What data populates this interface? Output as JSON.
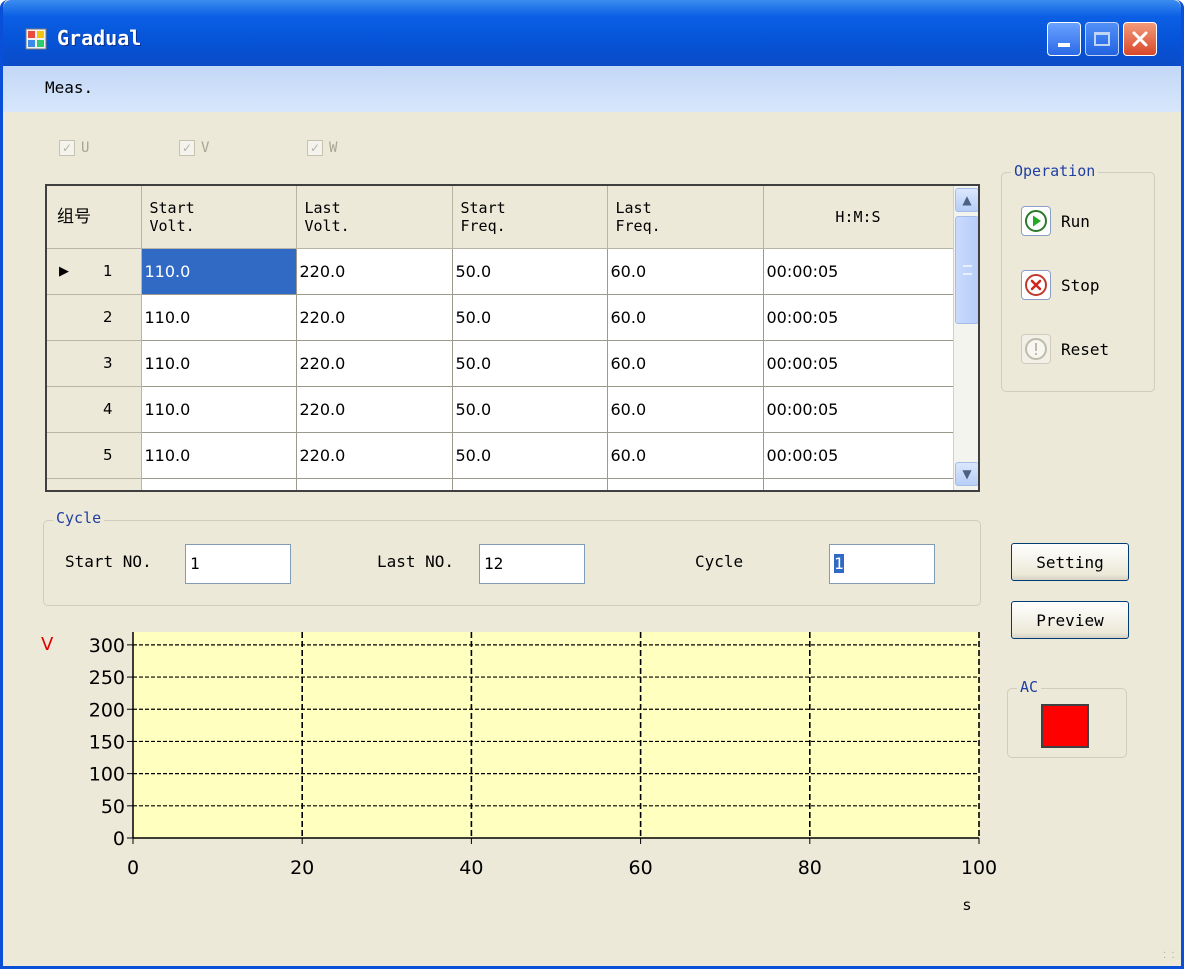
{
  "window": {
    "title": "Gradual",
    "minimize_label": "_",
    "maximize_label": "□",
    "close_label": "✕"
  },
  "menu": {
    "items": [
      "Meas."
    ]
  },
  "phases": [
    {
      "label": "U",
      "checked": true,
      "enabled": false
    },
    {
      "label": "V",
      "checked": true,
      "enabled": false
    },
    {
      "label": "W",
      "checked": true,
      "enabled": false
    }
  ],
  "grid": {
    "corner_header": "组号",
    "columns": [
      "Start\nVolt.",
      "Last\nVolt.",
      "Start\nFreq.",
      "Last\nFreq.",
      "H:M:S"
    ],
    "rows": [
      {
        "no": "1",
        "cells": [
          "110.0",
          "220.0",
          "50.0",
          "60.0",
          "00:00:05"
        ]
      },
      {
        "no": "2",
        "cells": [
          "110.0",
          "220.0",
          "50.0",
          "60.0",
          "00:00:05"
        ]
      },
      {
        "no": "3",
        "cells": [
          "110.0",
          "220.0",
          "50.0",
          "60.0",
          "00:00:05"
        ]
      },
      {
        "no": "4",
        "cells": [
          "110.0",
          "220.0",
          "50.0",
          "60.0",
          "00:00:05"
        ]
      },
      {
        "no": "5",
        "cells": [
          "110.0",
          "220.0",
          "50.0",
          "60.0",
          "00:00:05"
        ]
      }
    ],
    "current_row_indicator": "▶"
  },
  "operation": {
    "title": "Operation",
    "run_label": "Run",
    "stop_label": "Stop",
    "reset_label": "Reset"
  },
  "cycle": {
    "title": "Cycle",
    "start_label": "Start NO.",
    "start_value": "1",
    "last_label": "Last NO.",
    "last_value": "12",
    "cycle_label": "Cycle",
    "cycle_value": "1"
  },
  "buttons": {
    "setting": "Setting",
    "preview": "Preview"
  },
  "ac": {
    "title": "AC",
    "color": "#ff0000"
  },
  "colors": {
    "plot_bg": "#ffffc0",
    "ylabel": "#e00000",
    "selection": "#316ac5"
  },
  "chart_data": {
    "type": "line",
    "ylabel": "V",
    "xlabel": "s",
    "xlim": [
      0,
      100
    ],
    "ylim": [
      0,
      320
    ],
    "x_ticks": [
      0,
      20,
      40,
      60,
      80,
      100
    ],
    "y_ticks": [
      0,
      50,
      100,
      150,
      200,
      250,
      300
    ],
    "grid": true,
    "series": []
  }
}
